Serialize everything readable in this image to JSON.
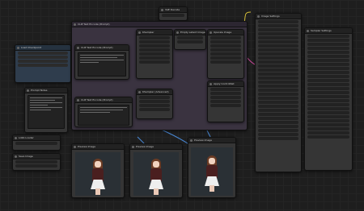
{
  "window": {
    "title": "ComfyUI workflow"
  },
  "nodes": {
    "reroute_top": "VAE Decode",
    "load_checkpoint": "Load Checkpoint",
    "lora_loader": "LoRA Loader",
    "clip_text_positive": "CLIP Text Encode (Prompt)",
    "clip_text_negative": "CLIP Text Encode (Prompt)",
    "ksampler_1": "KSampler",
    "ksampler_2": "KSampler (Advanced)",
    "upscale": "Upscale Image",
    "empty_latent": "Empty Latent Image",
    "controlnet": "Apply ControlNet",
    "right_panel_1": "Image Settings",
    "right_panel_2": "Sampler Settings",
    "preview_1": "Preview Image",
    "preview_2": "Preview Image",
    "preview_3": "Preview Image",
    "save_image": "Save Image",
    "left_text": "Prompt Notes"
  },
  "colors": {
    "canvas": "#1e1e1e",
    "node": "#353535",
    "node_blue": "#2f3d4d",
    "wire_yellow": "#d9c23a",
    "wire_pink": "#d04b9f",
    "wire_blue": "#4a8ad8",
    "wire_orange": "#e08a3a",
    "wire_green": "#6fbf5a"
  }
}
